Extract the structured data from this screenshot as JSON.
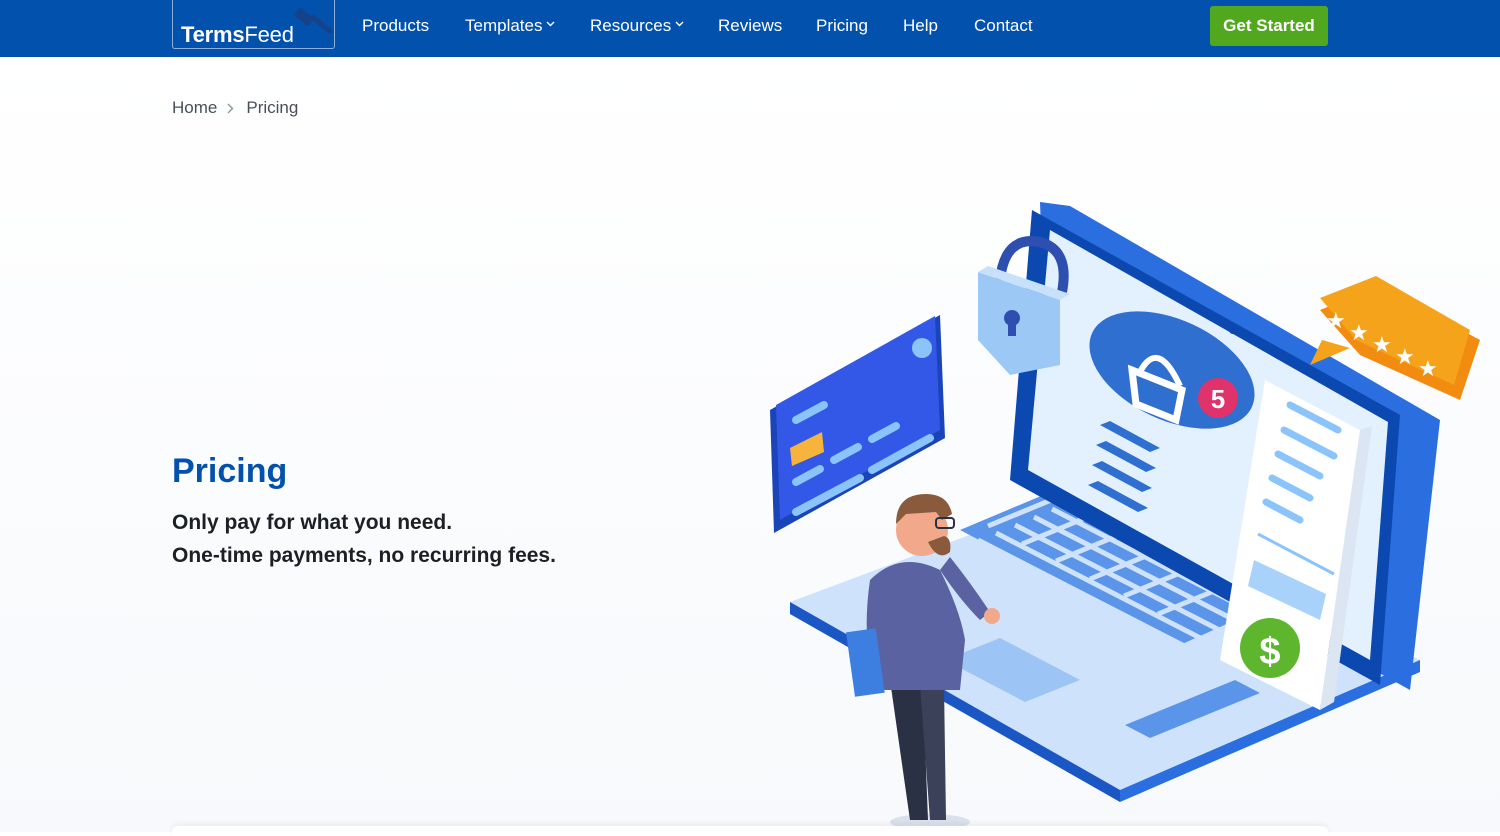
{
  "nav": {
    "logo_bold": "Terms",
    "logo_light": "Feed",
    "items": [
      {
        "label": "Products",
        "dropdown": false
      },
      {
        "label": "Templates",
        "dropdown": true
      },
      {
        "label": "Resources",
        "dropdown": true
      },
      {
        "label": "Reviews",
        "dropdown": false
      },
      {
        "label": "Pricing",
        "dropdown": false
      },
      {
        "label": "Help",
        "dropdown": false
      },
      {
        "label": "Contact",
        "dropdown": false
      }
    ],
    "cta": "Get Started"
  },
  "breadcrumb": {
    "home": "Home",
    "current": "Pricing"
  },
  "hero": {
    "title": "Pricing",
    "line1": "Only pay for what you need.",
    "line2": "One-time payments, no recurring fees."
  },
  "illustration": {
    "cart_badge": "5",
    "dollar_symbol": "$",
    "rating_stars": 5
  },
  "colors": {
    "brand_blue": "#0151ad",
    "cta_green": "#51a81e",
    "rating_orange": "#f5a31b",
    "badge_pink": "#e0336b"
  }
}
